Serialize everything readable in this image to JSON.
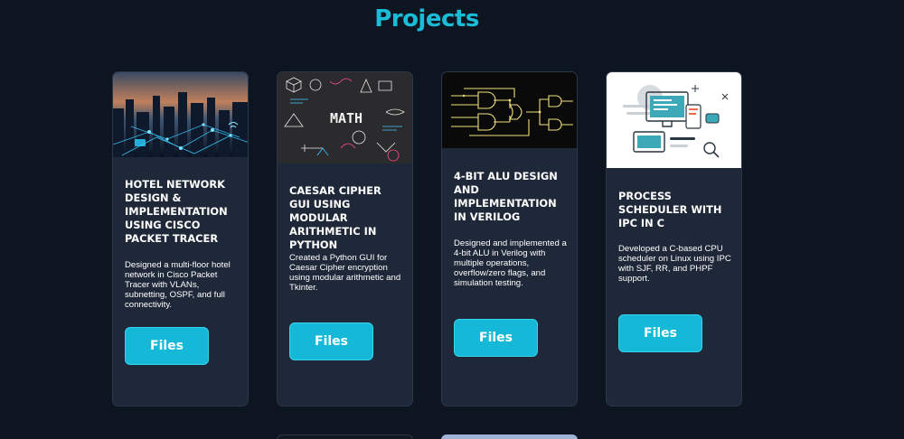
{
  "section": {
    "title": "Projects"
  },
  "projects": [
    {
      "title": "Hotel Network Design & Implementation using Cisco Packet Tracer",
      "description": "Designed a multi-floor hotel network in Cisco Packet Tracer with VLANs, subnetting, OSPF, and full connectivity.",
      "button_label": "Files",
      "image": "city-network-illustration"
    },
    {
      "title": "Caesar Cipher GUI using Modular Arithmetic in Python",
      "description": "Created a Python GUI for Caesar Cipher encryption using modular arithmetic and Tkinter.",
      "button_label": "Files",
      "image": "math-chalkboard-illustration",
      "image_text": "MATH"
    },
    {
      "title": "4-bit ALU Design and Implementation in Verilog",
      "description": "Designed and implemented a 4-bit ALU in Verilog with multiple operations, overflow/zero flags, and simulation testing.",
      "button_label": "Files",
      "image": "logic-circuit-illustration"
    },
    {
      "title": "Process Scheduler with IPC in C",
      "description": "Developed a C-based CPU scheduler on Linux using IPC with SJF, RR, and PHPF support.",
      "button_label": "Files",
      "image": "developer-desk-illustration"
    }
  ],
  "colors": {
    "background": "#0c1520",
    "card": "#1e2838",
    "accent": "#1bbcd8",
    "button": "#15b8d6"
  }
}
